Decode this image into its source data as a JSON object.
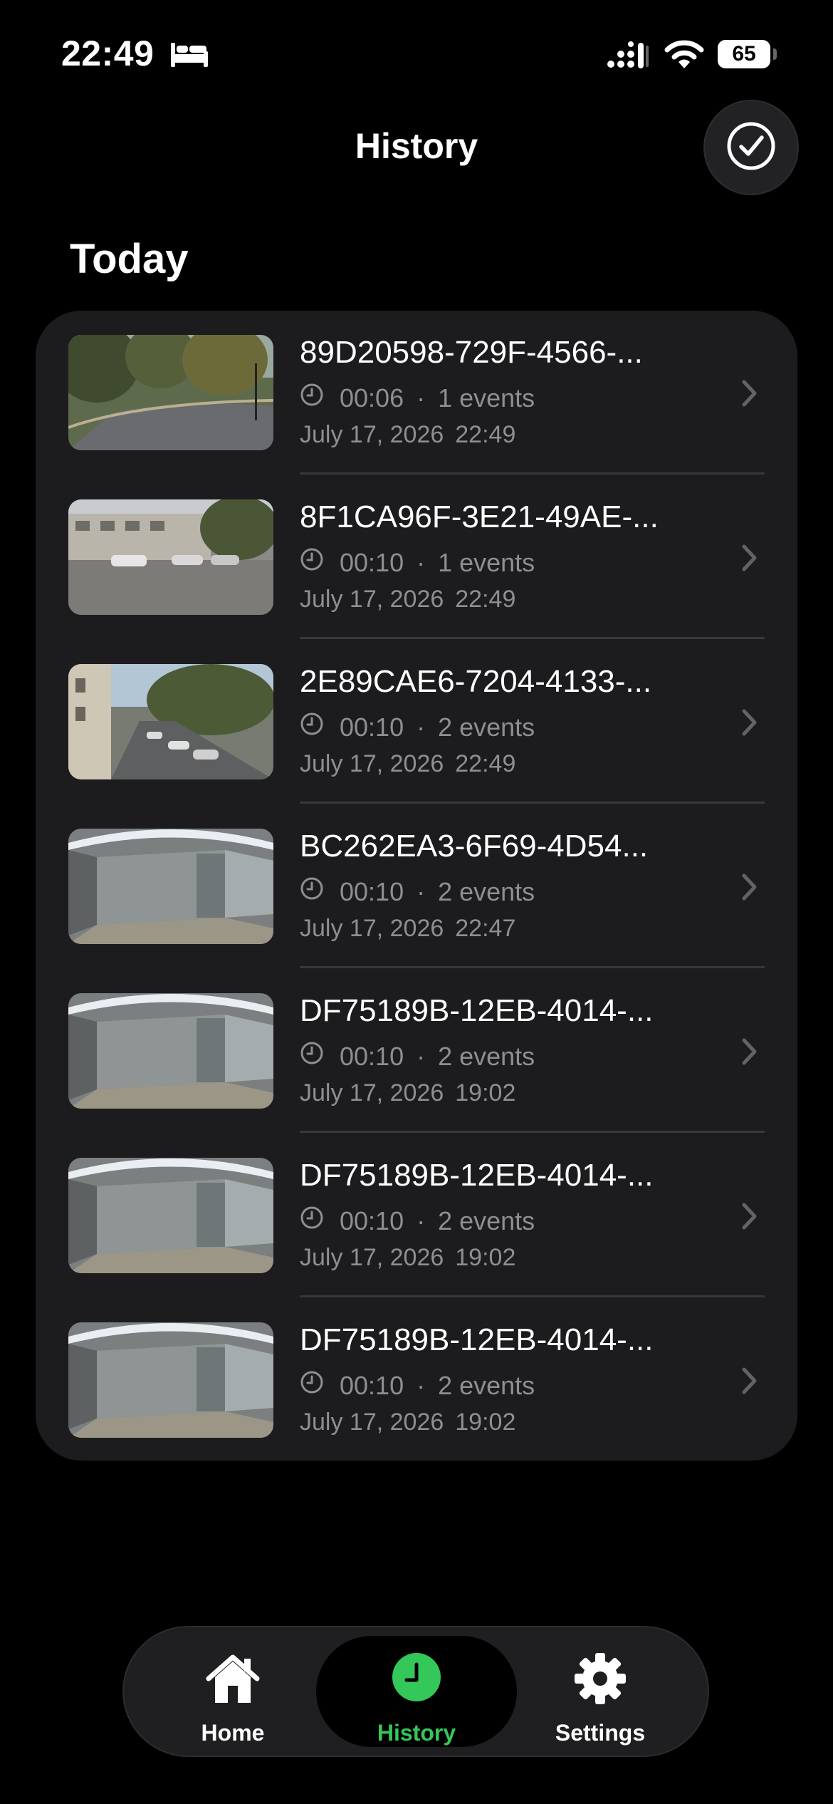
{
  "status_bar": {
    "time": "22:49",
    "battery": "65"
  },
  "header": {
    "title": "History",
    "done_icon": "checkmark-circle-icon"
  },
  "section": {
    "title": "Today"
  },
  "rows": [
    {
      "title": "89D20598-729F-4566-...",
      "duration": "00:06",
      "events": "1 events",
      "date": "July 17, 2026",
      "time": "22:49",
      "scene": "street"
    },
    {
      "title": "8F1CA96F-3E21-49AE-...",
      "duration": "00:10",
      "events": "1 events",
      "date": "July 17, 2026",
      "time": "22:49",
      "scene": "parking"
    },
    {
      "title": "2E89CAE6-7204-4133-...",
      "duration": "00:10",
      "events": "2 events",
      "date": "July 17, 2026",
      "time": "22:49",
      "scene": "avenue"
    },
    {
      "title": "BC262EA3-6F69-4D54...",
      "duration": "00:10",
      "events": "2 events",
      "date": "July 17, 2026",
      "time": "22:47",
      "scene": "hallway"
    },
    {
      "title": "DF75189B-12EB-4014-...",
      "duration": "00:10",
      "events": "2 events",
      "date": "July 17, 2026",
      "time": "19:02",
      "scene": "hallway"
    },
    {
      "title": "DF75189B-12EB-4014-...",
      "duration": "00:10",
      "events": "2 events",
      "date": "July 17, 2026",
      "time": "19:02",
      "scene": "hallway"
    },
    {
      "title": "DF75189B-12EB-4014-...",
      "duration": "00:10",
      "events": "2 events",
      "date": "July 17, 2026",
      "time": "19:02",
      "scene": "hallway"
    }
  ],
  "tab_bar": {
    "items": [
      {
        "label": "Home",
        "icon": "house-icon",
        "active": false
      },
      {
        "label": "History",
        "icon": "clock-icon",
        "active": true
      },
      {
        "label": "Settings",
        "icon": "gear-icon",
        "active": false
      }
    ]
  },
  "colors": {
    "accent": "#34c759",
    "card": "#1c1c1e",
    "secondary_text": "#8e8e93"
  }
}
